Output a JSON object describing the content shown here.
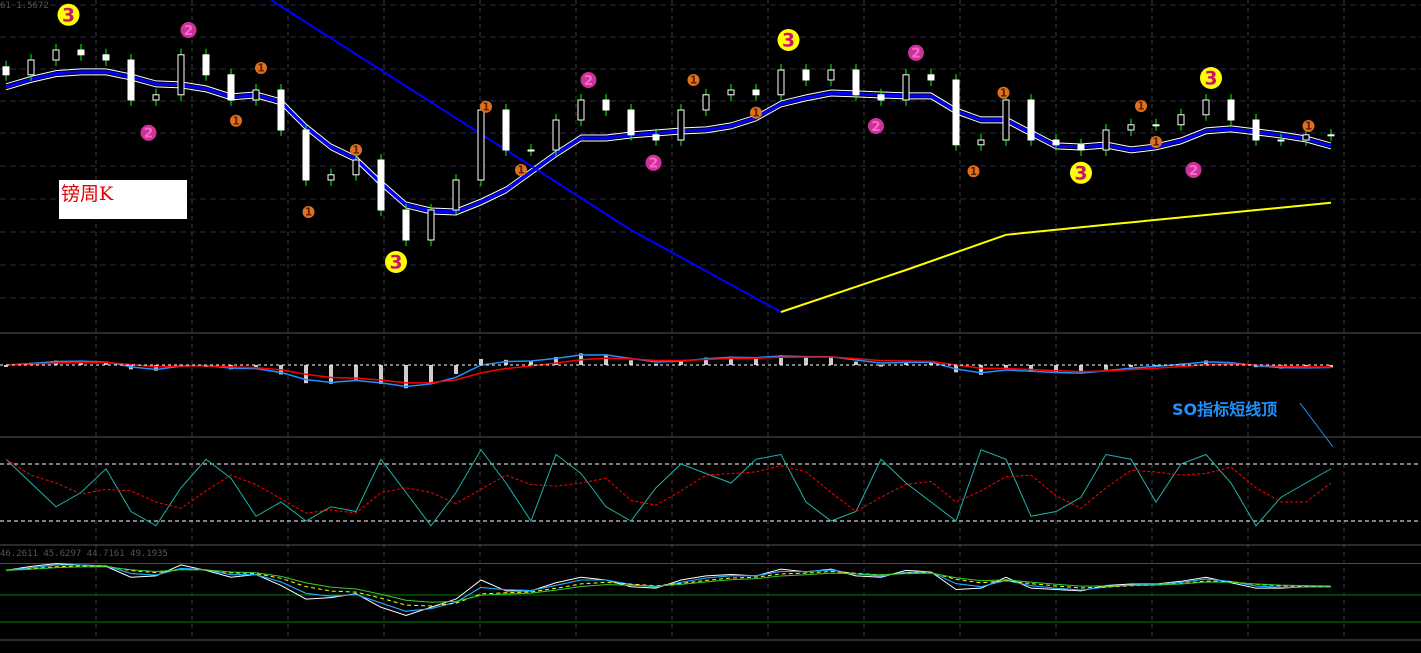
{
  "header": {
    "price_readout": "61 1.5672"
  },
  "annotations": {
    "chart_label": "镑周K",
    "so_note": "SO指标短线顶"
  },
  "lower_pane": {
    "readout": "46.2611 45.6297 44.7161 49.1935"
  },
  "colors": {
    "bull": "#ffffff",
    "bear": "#ffffff",
    "wick": "#00ff00",
    "ma_band": "#0000ff",
    "trend_blue": "#0000ff",
    "trend_yellow": "#ffff00",
    "grid": "#3a3a3a",
    "stoch_main": "#20b2aa",
    "stoch_signal": "#ff0000"
  },
  "chart_data": [
    {
      "type": "candlestick",
      "title": "GBP weekly",
      "ylim": [
        1.4925,
        1.575
      ],
      "closes": [
        1.5563,
        1.56,
        1.5625,
        1.5613,
        1.56,
        1.55,
        1.5513,
        1.5613,
        1.5563,
        1.55,
        1.5525,
        1.5425,
        1.53,
        1.5313,
        1.535,
        1.5225,
        1.515,
        1.5225,
        1.53,
        1.5475,
        1.5375,
        1.5375,
        1.545,
        1.55,
        1.5475,
        1.5413,
        1.54,
        1.5475,
        1.5513,
        1.5525,
        1.5513,
        1.5575,
        1.555,
        1.5575,
        1.5513,
        1.55,
        1.5563,
        1.555,
        1.5388,
        1.54,
        1.55,
        1.54,
        1.5388,
        1.5375,
        1.5425,
        1.5438,
        1.5438,
        1.5463,
        1.55,
        1.545,
        1.54,
        1.54,
        1.5413,
        1.5413
      ],
      "trend_blue": [
        [
          10.6,
          1.575
        ],
        [
          20,
          1.5375
        ],
        [
          25,
          1.5175
        ],
        [
          31,
          1.497
        ]
      ],
      "trend_yellow": [
        [
          31,
          1.497
        ],
        [
          36,
          1.5075
        ],
        [
          40,
          1.5163
        ],
        [
          44,
          1.5188
        ],
        [
          53,
          1.5243
        ]
      ],
      "markers": [
        {
          "i": 2.5,
          "price": 1.5713,
          "kind": "yellow",
          "text": "3"
        },
        {
          "i": 15.6,
          "price": 1.5095,
          "kind": "yellow",
          "text": "3"
        },
        {
          "i": 31.3,
          "price": 1.565,
          "kind": "yellow",
          "text": "3"
        },
        {
          "i": 43,
          "price": 1.5318,
          "kind": "yellow",
          "text": "3"
        },
        {
          "i": 48.2,
          "price": 1.5555,
          "kind": "yellow",
          "text": "3"
        },
        {
          "i": 7.3,
          "price": 1.5675,
          "kind": "pink",
          "text": "2"
        },
        {
          "i": 5.7,
          "price": 1.5418,
          "kind": "pink",
          "text": "2"
        },
        {
          "i": 23.3,
          "price": 1.555,
          "kind": "pink",
          "text": "2"
        },
        {
          "i": 25.9,
          "price": 1.5343,
          "kind": "pink",
          "text": "2"
        },
        {
          "i": 36.4,
          "price": 1.5618,
          "kind": "pink",
          "text": "2"
        },
        {
          "i": 34.8,
          "price": 1.5435,
          "kind": "pink",
          "text": "2"
        },
        {
          "i": 47.5,
          "price": 1.5325,
          "kind": "pink",
          "text": "2"
        },
        {
          "i": 10.2,
          "price": 1.558,
          "kind": "orange",
          "text": "1"
        },
        {
          "i": 9.2,
          "price": 1.5448,
          "kind": "orange",
          "text": "1"
        },
        {
          "i": 12.1,
          "price": 1.522,
          "kind": "orange",
          "text": "1"
        },
        {
          "i": 14,
          "price": 1.5375,
          "kind": "orange",
          "text": "1"
        },
        {
          "i": 19.2,
          "price": 1.5483,
          "kind": "orange",
          "text": "1"
        },
        {
          "i": 20.6,
          "price": 1.5325,
          "kind": "orange",
          "text": "1"
        },
        {
          "i": 27.5,
          "price": 1.555,
          "kind": "orange",
          "text": "1"
        },
        {
          "i": 30,
          "price": 1.5468,
          "kind": "orange",
          "text": "1"
        },
        {
          "i": 39.9,
          "price": 1.5518,
          "kind": "orange",
          "text": "1"
        },
        {
          "i": 38.7,
          "price": 1.5322,
          "kind": "orange",
          "text": "1"
        },
        {
          "i": 45.4,
          "price": 1.5485,
          "kind": "orange",
          "text": "1"
        },
        {
          "i": 46,
          "price": 1.5395,
          "kind": "orange",
          "text": "1"
        },
        {
          "i": 52.1,
          "price": 1.5435,
          "kind": "orange",
          "text": "1"
        }
      ]
    },
    {
      "type": "line",
      "title": "Stochastic Oscillator",
      "ylim": [
        0,
        100
      ],
      "levels": [
        80,
        20
      ],
      "main": [
        85,
        60,
        35,
        50,
        75,
        30,
        15,
        55,
        85,
        65,
        25,
        40,
        20,
        35,
        30,
        85,
        50,
        15,
        50,
        95,
        60,
        20,
        90,
        70,
        35,
        20,
        55,
        80,
        70,
        60,
        85,
        90,
        40,
        20,
        30,
        85,
        60,
        40,
        20,
        95,
        85,
        25,
        30,
        45,
        90,
        85,
        40,
        80,
        90,
        60,
        15,
        45,
        60,
        75
      ]
    },
    {
      "type": "line",
      "title": "Lower oscillator",
      "ylim": [
        0,
        100
      ],
      "levels": [
        85,
        50,
        20
      ]
    }
  ]
}
